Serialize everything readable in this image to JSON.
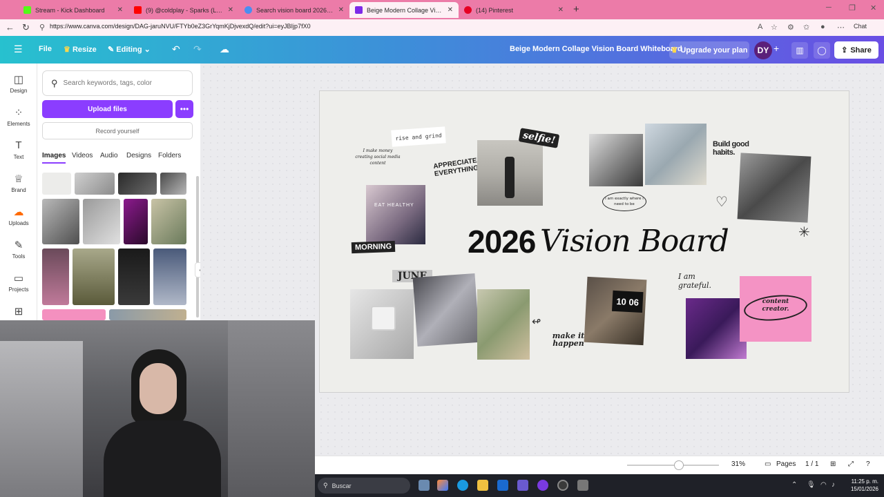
{
  "browser": {
    "tabs": [
      {
        "title": "Stream - Kick Dashboard",
        "fav": "#53fc18"
      },
      {
        "title": "(9) @coldplay - Sparks (Lyrics) - Yo",
        "fav": "#ff0000"
      },
      {
        "title": "Search vision board 2026 - Canva",
        "fav": "#4a8ef1"
      },
      {
        "title": "Beige Modern Collage Vision Board",
        "fav": "#7d2ae8"
      },
      {
        "title": "(14) Pinterest",
        "fav": "#e60023"
      }
    ],
    "url": "https://www.canva.com/design/DAG-jaruNVU/FTYb0eZ3GrYqmKjDjvexdQ/edit?ui=eyJBIjp7fX0",
    "chat_label": "Chat"
  },
  "header": {
    "file": "File",
    "resize": "Resize",
    "editing": "Editing",
    "design_title": "Beige Modern Collage Vision Board Whiteboard",
    "upgrade": "Upgrade your plan",
    "avatar": "DY",
    "share": "Share"
  },
  "rail": {
    "items": [
      {
        "label": "Design"
      },
      {
        "label": "Elements"
      },
      {
        "label": "Text"
      },
      {
        "label": "Brand"
      },
      {
        "label": "Uploads"
      },
      {
        "label": "Tools"
      },
      {
        "label": "Projects"
      }
    ]
  },
  "panel": {
    "search_placeholder": "Search keywords, tags, color",
    "upload": "Upload files",
    "record": "Record yourself",
    "tabs": [
      "Images",
      "Videos",
      "Audio",
      "Designs",
      "Folders"
    ]
  },
  "board": {
    "title_num": "2026",
    "title_vb": "Vision Board",
    "morning": "MORNING",
    "june": "JUNE",
    "selfie": "selfie!",
    "rise": "rise and grind",
    "money_note": "I make money creating social media content",
    "appreciate": "APPRECIATE EVERYTHING",
    "exactly": "I am exactly where I need to be",
    "habits": "Build good habits.",
    "grateful": "I am grateful.",
    "make_it": "make it happen",
    "content_creator": "content creator.",
    "eat": "EAT HEALTHY",
    "clock": "10 06"
  },
  "bottombar": {
    "zoom": "31%",
    "pages": "Pages",
    "page_count": "1 / 1"
  },
  "taskbar": {
    "search": "Buscar",
    "time": "11:25 p. m.",
    "date": "15/01/2026"
  },
  "colors": {
    "canva_purple": "#8b3dff",
    "tabbar_pink": "#ec7ba8"
  }
}
